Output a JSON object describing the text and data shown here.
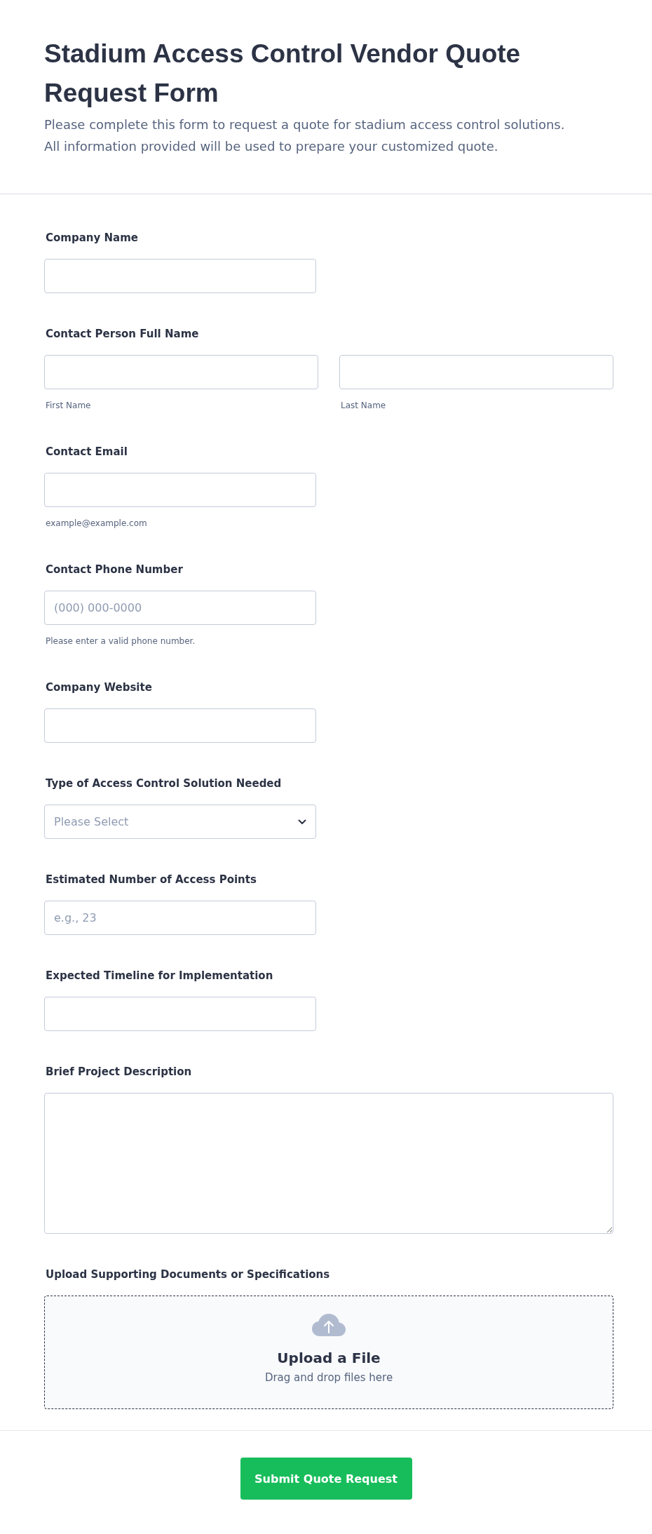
{
  "header": {
    "title": "Stadium Access Control Vendor Quote Request Form",
    "description": [
      "Please complete this form to request a quote for stadium access control solutions.",
      "All information provided will be used to prepare your customized quote."
    ]
  },
  "fields": [
    {
      "kind": "text",
      "label": "Company Name"
    },
    {
      "kind": "name",
      "label": "Contact Person Full Name",
      "inputs": [
        {
          "sublabel": "First Name"
        },
        {
          "sublabel": "Last Name"
        }
      ]
    },
    {
      "kind": "text",
      "label": "Contact Email",
      "sublabel": "example@example.com"
    },
    {
      "kind": "text",
      "label": "Contact Phone Number",
      "placeholder": "(000) 000-0000",
      "sublabel": "Please enter a valid phone number."
    },
    {
      "kind": "text",
      "label": "Company Website"
    },
    {
      "kind": "select",
      "label": "Type of Access Control Solution Needed",
      "placeholder": "Please Select"
    },
    {
      "kind": "text",
      "label": "Estimated Number of Access Points",
      "placeholder": "e.g., 23"
    },
    {
      "kind": "text",
      "label": "Expected Timeline for Implementation"
    },
    {
      "kind": "textarea",
      "label": "Brief Project Description"
    },
    {
      "kind": "upload",
      "label": "Upload Supporting Documents or Specifications",
      "title": "Upload a File",
      "hint": "Drag and drop files here"
    }
  ],
  "submit_button": {
    "label": "Submit Quote Request"
  }
}
